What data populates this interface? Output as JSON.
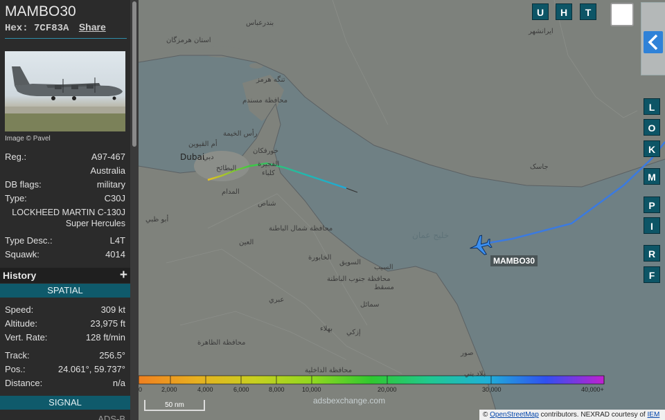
{
  "aircraft": {
    "callsign": "MAMBO30",
    "hex_label": "Hex:",
    "hex": "7CF83A",
    "share_label": "Share",
    "image_credit": "Image © Pavel",
    "reg_label": "Reg.:",
    "reg": "A97-467",
    "country": "Australia",
    "dbflags_label": "DB flags:",
    "dbflags": "military",
    "type_label": "Type:",
    "type": "C30J",
    "type_full_1": "LOCKHEED MARTIN C-130J",
    "type_full_2": "Super Hercules",
    "type_desc_label": "Type Desc.:",
    "type_desc": "L4T",
    "squawk_label": "Squawk:",
    "squawk": "4014"
  },
  "history": {
    "label": "History",
    "plus": "+"
  },
  "spatial": {
    "label": "SPATIAL",
    "speed_label": "Speed:",
    "speed": "309 kt",
    "altitude_label": "Altitude:",
    "altitude": "23,975 ft",
    "vrate_label": "Vert. Rate:",
    "vrate": "128 ft/min",
    "track_label": "Track:",
    "track": "256.5°",
    "pos_label": "Pos.:",
    "pos": "24.061°, 59.737°",
    "distance_label": "Distance:",
    "distance": "n/a"
  },
  "signal": {
    "label": "SIGNAL",
    "source_partial": "ADS-B"
  },
  "map_buttons": {
    "top": [
      "U",
      "H",
      "T"
    ],
    "side": [
      "L",
      "O",
      "K",
      "M",
      "P",
      "I",
      "R",
      "F"
    ],
    "collapse_icon": "chevron-left-icon"
  },
  "map": {
    "plane_label": "MAMBO30",
    "scale": "50 nm",
    "watermark": "adsbexchange.com",
    "attribution_prefix": "©",
    "attribution_osm": "OpenStreetMap",
    "attribution_mid": "contributors. NEXRAD courtesy of",
    "attribution_iem": "IEM",
    "labels": {
      "bandar_abbas": "بندرعباس",
      "hormozgan": "استان هرمزگان",
      "iranshahr": "ایرانشهر",
      "hormuz_strait": "تنگه هرمز",
      "musandam": "محافظة مسندم",
      "ras_khaimah": "رأس الخيمة",
      "umm_quwain": "أم القيوين",
      "dubai": "Dubai",
      "dubai_ar": "دبي",
      "khor_fakkan": "خورفكان",
      "fujairah": "الفجيرة",
      "kalba": "كلباء",
      "batayih": "البطائح",
      "madam": "المدام",
      "shinas": "شناص",
      "abu_dhabi": "أبو ظبي",
      "jask": "جاسک",
      "gulf_of_oman": "خليج عمان",
      "north_batinah": "محافظة شمال الباطنة",
      "al_ain": "العين",
      "khabourah": "الخابورة",
      "suwaiq": "السويق",
      "seeb": "السيب",
      "south_batinah": "محافظة جنوب الباطنة",
      "muscat": "مسقط",
      "ibri": "عبري",
      "samail": "سمائل",
      "dhahirah": "محافظة الظاهرة",
      "izki": "إزكي",
      "bahla": "بهلاء",
      "dakhiliyah": "محافظة الداخلية",
      "sur": "صور",
      "bilad_bani": "بلاد بني"
    }
  },
  "altitude_legend": {
    "ticks": [
      "0",
      "2,000",
      "4,000",
      "6,000",
      "8,000",
      "10,000",
      "20,000",
      "30,000",
      "40,000+"
    ],
    "colors": [
      "#f08020",
      "#e8b020",
      "#c8d020",
      "#90d820",
      "#30c830",
      "#20c890",
      "#20b0d8",
      "#3050f0",
      "#c020d0"
    ]
  }
}
